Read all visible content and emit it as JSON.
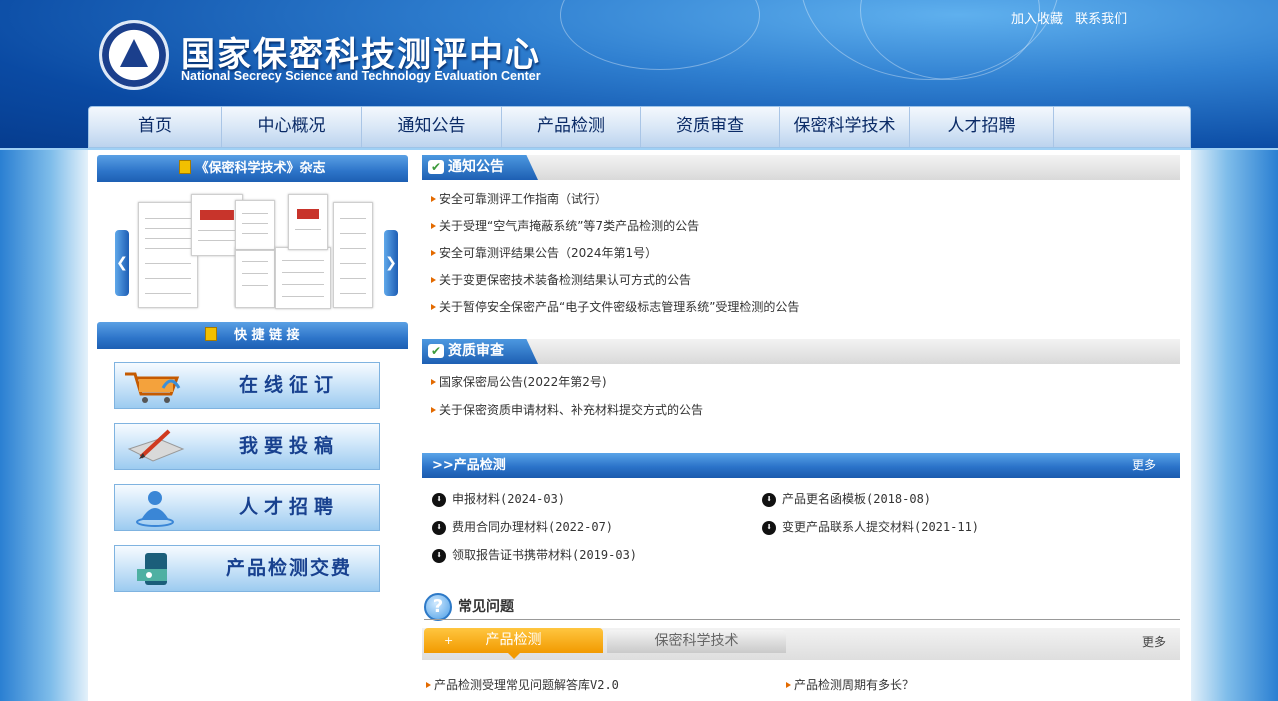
{
  "site": {
    "title": "国家保密科技测评中心",
    "subtitle": "National Secrecy Science and Technology Evaluation Center"
  },
  "top_links": [
    "加入收藏",
    "联系我们"
  ],
  "nav": [
    "首页",
    "中心概况",
    "通知公告",
    "产品检测",
    "资质审查",
    "保密科学技术",
    "人才招聘"
  ],
  "magazine": {
    "title": "《保密科学技术》杂志"
  },
  "quick_links": {
    "title": "快 捷 链 接",
    "buttons": [
      "在线征订",
      "我要投稿",
      "人才招聘",
      "产品检测交费"
    ]
  },
  "notices": {
    "title": "通知公告",
    "items": [
      "安全可靠测评工作指南（试行）",
      "关于受理“空气声掩蔽系统”等7类产品检测的公告",
      "安全可靠测评结果公告（2024年第1号）",
      "关于变更保密技术装备检测结果认可方式的公告",
      "关于暂停安全保密产品“电子文件密级标志管理系统”受理检测的公告"
    ]
  },
  "qualification": {
    "title": "资质审查",
    "items": [
      "国家保密局公告(2022年第2号)",
      "关于保密资质申请材料、补充材料提交方式的公告"
    ]
  },
  "product_testing": {
    "title": ">>产品检测",
    "more": "更多",
    "items": [
      "申报材料(2024-03)",
      "产品更名函模板(2018-08)",
      "费用合同办理材料(2022-07)",
      "变更产品联系人提交材料(2021-11)",
      "领取报告证书携带材料(2019-03)"
    ]
  },
  "faq": {
    "title": "常见问题",
    "tabs": [
      "产品检测",
      "保密科学技术"
    ],
    "more": "更多",
    "items": [
      "产品检测受理常见问题解答库V2.0",
      "产品检测周期有多长？"
    ]
  },
  "colors": {
    "accent": "#1d5fb3",
    "orange": "#f29a00",
    "header_bg": "#0a4aa3"
  }
}
